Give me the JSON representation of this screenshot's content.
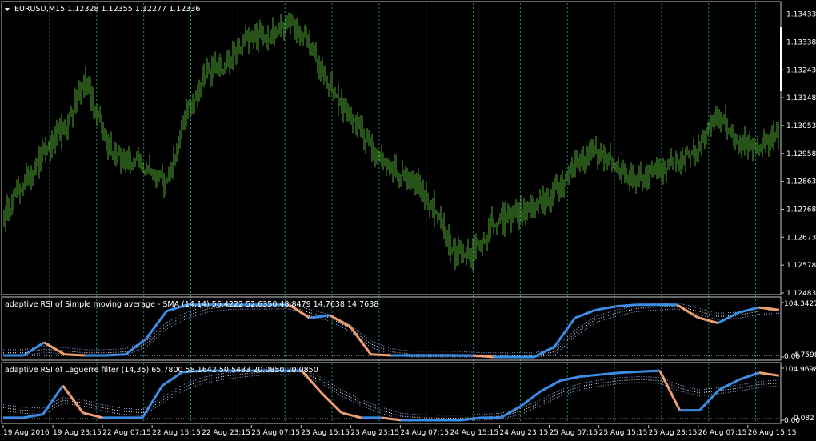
{
  "colors": {
    "background": "#000000",
    "candle": "#52a832",
    "frame": "#c8c8c8",
    "text": "#ffffff",
    "separator": "#2a9a9a",
    "rsi_up": "#3a8ee6",
    "rsi_down": "#f0a070",
    "band": "#a0b4ff"
  },
  "main": {
    "symbol_header": "EURUSD,M15  1.12328 1.12355 1.12277 1.12336",
    "header_icon": "triangle-down-icon"
  },
  "indicator1": {
    "header": "adaptive RSI of Simple moving average - SMA (14,14) 56.4222 52.6350 48.8479 14.7638 14.7638",
    "max_label": "104.3427",
    "min_label": "0.00",
    "level_label": "4.7598"
  },
  "indicator2": {
    "header": "adaptive RSI of Laguerre filter (14,35) 65.7800 58.1642 50.5483 20.0850 20.0850",
    "max_label": "104.9698",
    "min_label": "0.00",
    "level_label": "0.082"
  },
  "x_axis": {
    "labels": [
      "19 Aug 2016",
      "19 Aug 23:15",
      "22 Aug 07:15",
      "22 Aug 15:15",
      "22 Aug 23:15",
      "23 Aug 07:15",
      "23 Aug 15:15",
      "23 Aug 23:15",
      "24 Aug 07:15",
      "24 Aug 15:15",
      "24 Aug 23:15",
      "25 Aug 07:15",
      "25 Aug 15:15",
      "25 Aug 23:15",
      "26 Aug 07:15",
      "26 Aug 15:15"
    ]
  },
  "chart_data": [
    {
      "type": "bar",
      "subtype": "ohlc",
      "series": [
        {
          "name": "EURUSD,M15",
          "values": [
            1.1275,
            1.1286,
            1.1296,
            1.1305,
            1.1321,
            1.13,
            1.1293,
            1.1291,
            1.1286,
            1.1311,
            1.1324,
            1.1326,
            1.1336,
            1.1336,
            1.1341,
            1.1332,
            1.1318,
            1.1308,
            1.1298,
            1.1291,
            1.1287,
            1.1279,
            1.1262,
            1.1262,
            1.1272,
            1.1275,
            1.1277,
            1.1282,
            1.1293,
            1.1296,
            1.1292,
            1.1287,
            1.129,
            1.1292,
            1.1296,
            1.131,
            1.13,
            1.1299,
            1.1302
          ]
        }
      ],
      "y_ticks": [
        "1.13433",
        "1.13338",
        "1.13243",
        "1.13148",
        "1.13053",
        "1.12958",
        "1.12863",
        "1.12768",
        "1.12673",
        "1.12578",
        "1.12483"
      ],
      "ylim": [
        1.12483,
        1.1347
      ]
    },
    {
      "type": "line",
      "series": [
        {
          "values": [
            3,
            3,
            28,
            5,
            3,
            3,
            5,
            35,
            88,
            100,
            100,
            100,
            100,
            100,
            100,
            75,
            80,
            58,
            5,
            3,
            3,
            3,
            3,
            3,
            0,
            0,
            0,
            20,
            75,
            90,
            97,
            100,
            100,
            100,
            76,
            65,
            85,
            95,
            90
          ]
        },
        {
          "values": [
            3,
            3,
            3,
            3,
            3,
            3,
            3,
            3,
            3,
            3,
            3,
            3,
            3,
            3,
            3,
            3,
            3,
            3,
            3,
            3,
            3,
            3,
            3,
            3,
            3,
            3,
            3,
            3,
            3,
            3,
            3,
            3,
            3,
            3,
            3,
            3,
            3,
            3,
            3
          ]
        },
        {
          "values": [
            8,
            8,
            15,
            12,
            8,
            8,
            10,
            25,
            60,
            80,
            92,
            97,
            98,
            98,
            98,
            85,
            75,
            55,
            25,
            10,
            5,
            5,
            5,
            3,
            2,
            2,
            2,
            10,
            45,
            72,
            84,
            93,
            96,
            98,
            88,
            78,
            80,
            88,
            90
          ]
        }
      ],
      "ylim": [
        0,
        104.3427
      ]
    },
    {
      "type": "line",
      "series": [
        {
          "values": [
            5,
            5,
            12,
            70,
            15,
            5,
            5,
            5,
            70,
            97,
            100,
            100,
            100,
            100,
            100,
            100,
            55,
            15,
            5,
            5,
            0,
            0,
            0,
            0,
            5,
            5,
            28,
            58,
            80,
            88,
            92,
            96,
            98,
            100,
            20,
            20,
            62,
            82,
            96,
            90
          ]
        },
        {
          "values": [
            3,
            3,
            3,
            3,
            3,
            3,
            3,
            3,
            3,
            3,
            3,
            3,
            3,
            3,
            3,
            3,
            3,
            3,
            3,
            3,
            0,
            0,
            0,
            0,
            3,
            3,
            3,
            3,
            3,
            3,
            3,
            3,
            3,
            3,
            3,
            3,
            3,
            3,
            3,
            3
          ]
        },
        {
          "values": [
            25,
            20,
            18,
            40,
            35,
            25,
            18,
            15,
            40,
            65,
            80,
            88,
            93,
            97,
            98,
            97,
            80,
            55,
            35,
            20,
            8,
            5,
            4,
            4,
            6,
            8,
            18,
            35,
            55,
            68,
            75,
            80,
            82,
            80,
            65,
            55,
            60,
            65,
            72,
            75
          ]
        }
      ],
      "ylim": [
        0,
        104.9698
      ]
    }
  ]
}
